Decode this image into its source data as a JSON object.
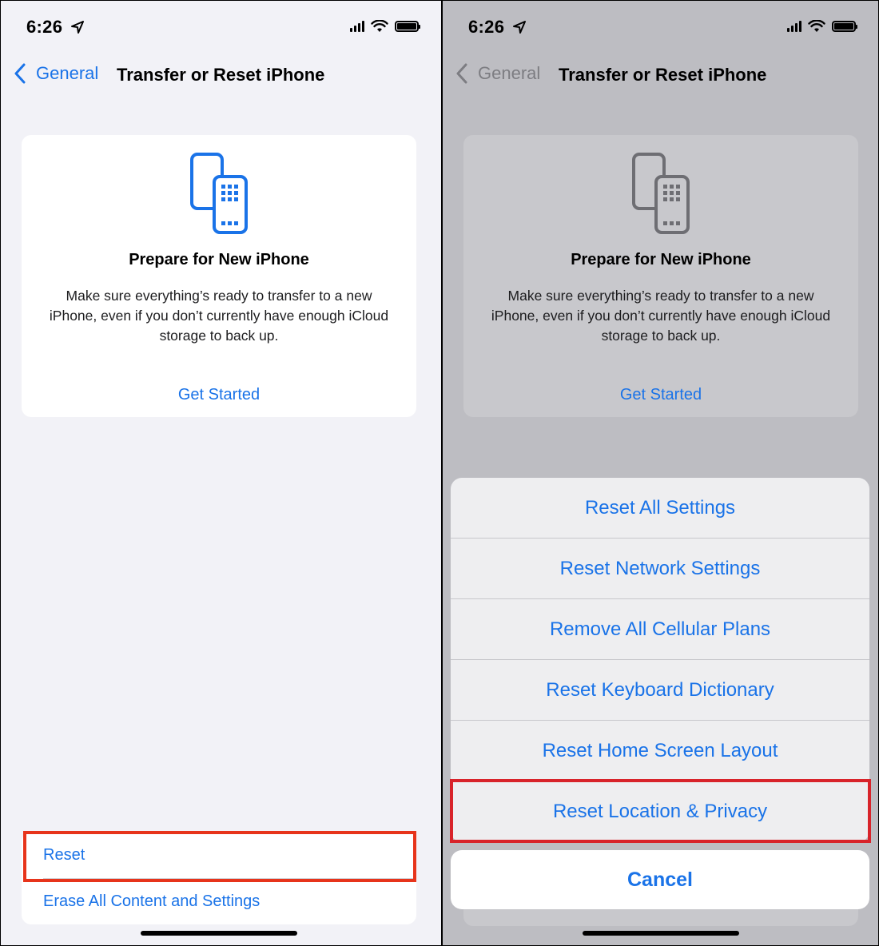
{
  "left": {
    "status": {
      "time": "6:26"
    },
    "nav": {
      "back_label": "General",
      "title": "Transfer or Reset iPhone"
    },
    "card": {
      "title": "Prepare for New iPhone",
      "body": "Make sure everything’s ready to transfer to a new iPhone, even if you don’t currently have enough iCloud storage to back up.",
      "link": "Get Started"
    },
    "list": [
      {
        "label": "Reset"
      },
      {
        "label": "Erase All Content and Settings"
      }
    ]
  },
  "right": {
    "status": {
      "time": "6:26"
    },
    "nav": {
      "back_label": "General",
      "title": "Transfer or Reset iPhone"
    },
    "card": {
      "title": "Prepare for New iPhone",
      "body": "Make sure everything’s ready to transfer to a new iPhone, even if you don’t currently have enough iCloud storage to back up.",
      "link": "Get Started"
    },
    "sheet": {
      "items": [
        {
          "label": "Reset All Settings"
        },
        {
          "label": "Reset Network Settings"
        },
        {
          "label": "Remove All Cellular Plans"
        },
        {
          "label": "Reset Keyboard Dictionary"
        },
        {
          "label": "Reset Home Screen Layout"
        },
        {
          "label": "Reset Location & Privacy"
        }
      ],
      "cancel_label": "Cancel"
    }
  },
  "colors": {
    "accent": "#1a73e8",
    "highlight_left": "#e7341b",
    "highlight_right": "#d8232a",
    "dim_overlay": "#bdbdc2"
  },
  "icons": [
    "location-arrow-icon",
    "cellular-signal-icon",
    "wifi-icon",
    "battery-icon",
    "chevron-left-icon",
    "transfer-phones-icon"
  ]
}
